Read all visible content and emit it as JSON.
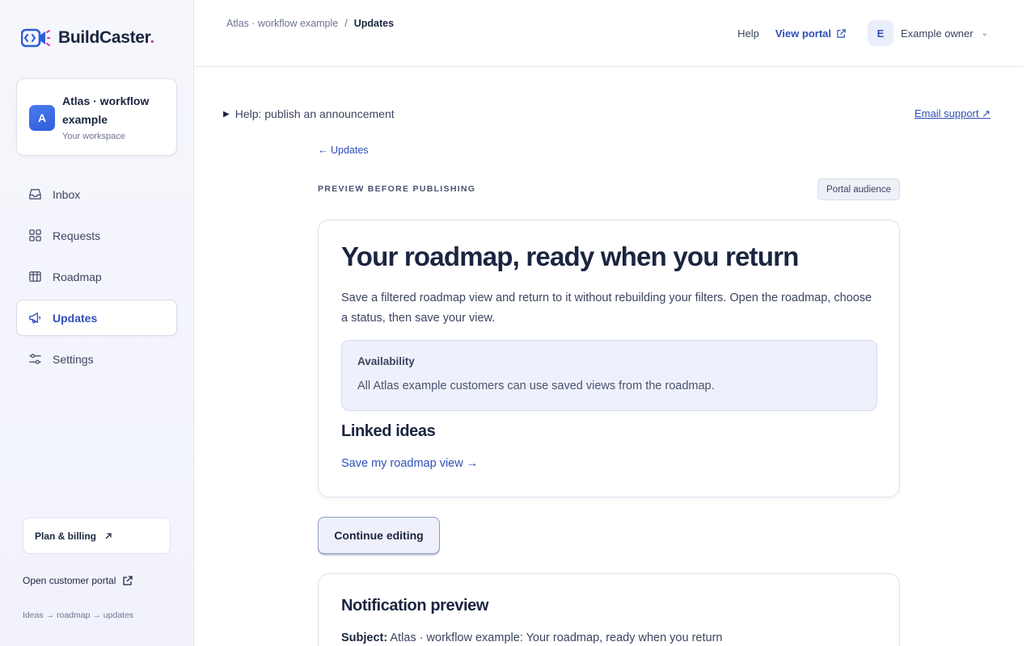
{
  "brand": {
    "name": "BuildCaster",
    "dot": ".",
    "accent": "#d63aa8",
    "primary": "#2d4fb8"
  },
  "workspace": {
    "initial": "A",
    "name": "Atlas · workflow example",
    "subtitle": "Your workspace"
  },
  "nav": [
    {
      "label": "Inbox",
      "icon": "inbox-icon",
      "active": false
    },
    {
      "label": "Requests",
      "icon": "grid-icon",
      "active": false
    },
    {
      "label": "Roadmap",
      "icon": "roadmap-icon",
      "active": false
    },
    {
      "label": "Updates",
      "icon": "megaphone-icon",
      "active": true
    },
    {
      "label": "Settings",
      "icon": "sliders-icon",
      "active": false
    }
  ],
  "sidebar_footer": {
    "plan_label": "Plan & billing",
    "plan_icon": "arrow-up-right-icon",
    "open_portal_label": "Open customer portal",
    "open_portal_icon": "external-link-icon",
    "flow": "Ideas → roadmap → updates"
  },
  "breadcrumb": {
    "parent": "Atlas · workflow example",
    "separator": "/",
    "current": "Updates"
  },
  "topbar": {
    "help": "Help",
    "view_portal": "View portal",
    "avatar_initial": "E",
    "owner": "Example owner",
    "chevron": "⌄"
  },
  "main": {
    "help_toggle": "Help: publish an announcement",
    "email_support": "Email support ↗",
    "back": "← Updates",
    "eyebrow": "PREVIEW BEFORE PUBLISHING",
    "audience": "Portal audience",
    "card": {
      "title": "Your roadmap, ready when you return",
      "body": "Save a filtered roadmap view and return to it without rebuilding your filters. Open the roadmap, choose a status, then save your view.",
      "availability_title": "Availability",
      "availability_text": "All Atlas example customers can use saved views from the roadmap.",
      "linked_title": "Linked ideas",
      "linked_link": "Save my roadmap view →"
    },
    "continue_label": "Continue editing",
    "notification": {
      "title": "Notification preview",
      "subject_label": "Subject:",
      "subject_text": " Atlas · workflow example: Your roadmap, ready when you return"
    }
  }
}
